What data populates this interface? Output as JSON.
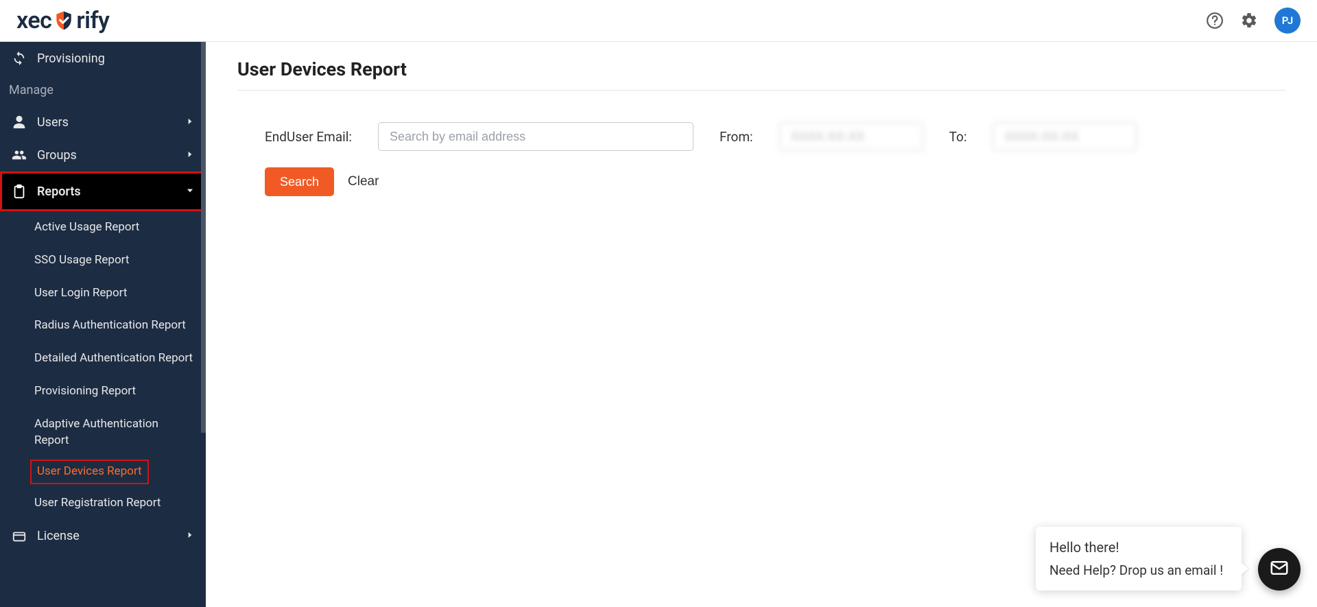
{
  "header": {
    "logo_pre": "xec",
    "logo_post": "rify",
    "avatar_initials": "PJ"
  },
  "sidebar": {
    "provisioning_label": "Provisioning",
    "manage_label": "Manage",
    "users_label": "Users",
    "groups_label": "Groups",
    "reports_label": "Reports",
    "license_label": "License",
    "reports_submenu": {
      "active_usage": "Active Usage Report",
      "sso_usage": "SSO Usage Report",
      "user_login": "User Login Report",
      "radius_auth": "Radius Authentication Report",
      "detailed_auth": "Detailed Authentication Report",
      "provisioning": "Provisioning Report",
      "adaptive_auth": "Adaptive Authentication Report",
      "user_devices": "User Devices Report",
      "user_registration": "User Registration Report"
    }
  },
  "page": {
    "title": "User Devices Report",
    "email_label": "EndUser Email:",
    "email_placeholder": "Search by email address",
    "from_label": "From:",
    "to_label": "To:",
    "search_button": "Search",
    "clear_button": "Clear"
  },
  "chat": {
    "line1": "Hello there!",
    "line2": "Need Help? Drop us an email !"
  }
}
